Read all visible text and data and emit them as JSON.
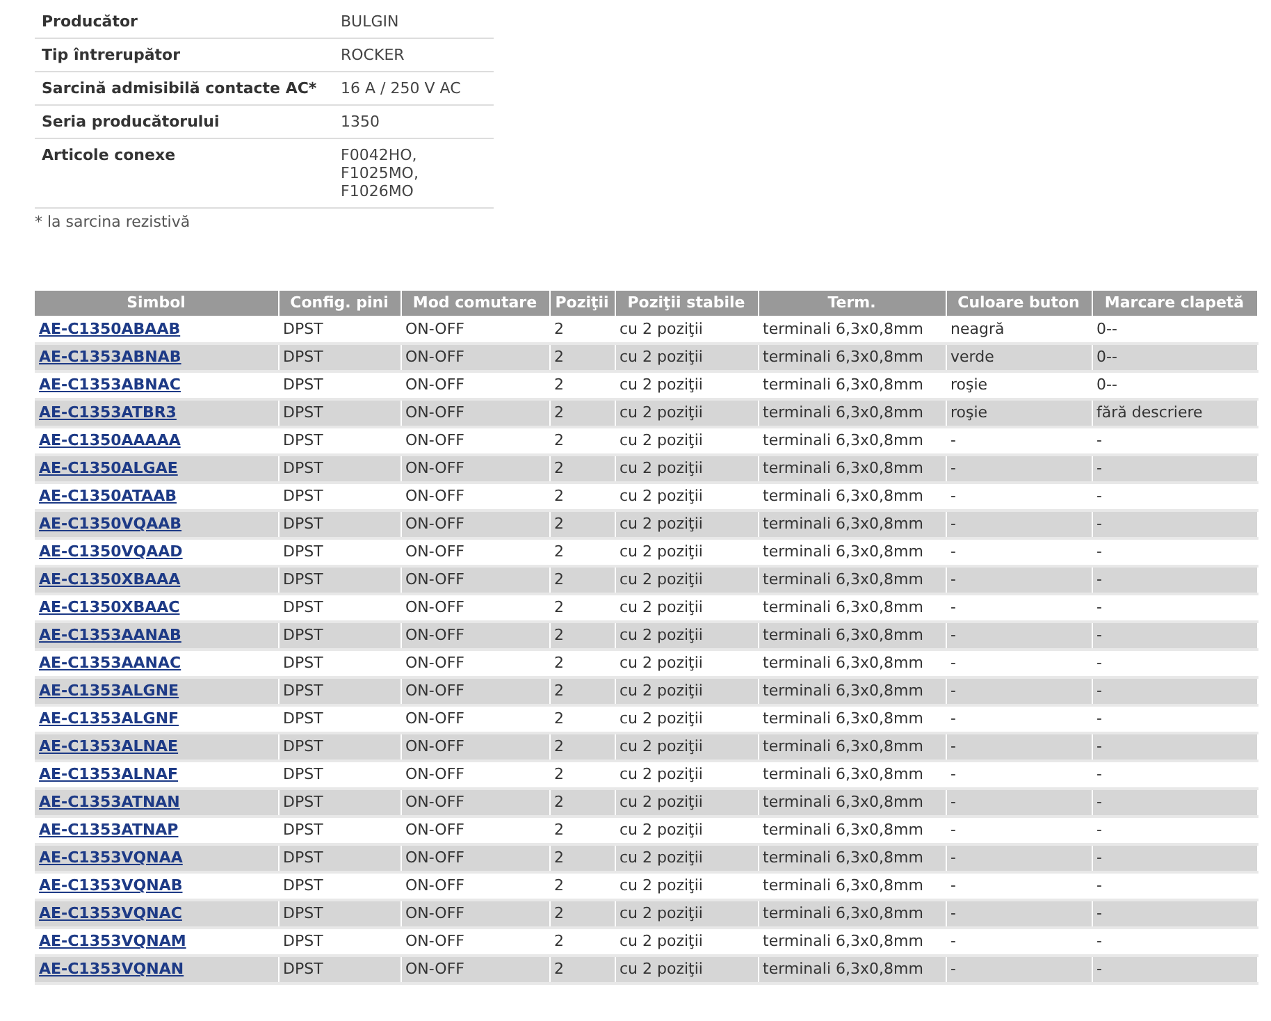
{
  "specs": [
    {
      "label": "Producător",
      "value": "BULGIN"
    },
    {
      "label": "Tip întrerupător",
      "value": "ROCKER"
    },
    {
      "label": "Sarcină admisibilă contacte AC*",
      "value": "16 A / 250 V AC"
    },
    {
      "label": "Seria producătorului",
      "value": "1350"
    },
    {
      "label": "Articole conexe",
      "value": "F0042HO,\nF1025MO,\nF1026MO"
    }
  ],
  "footnote": "* la sarcina rezistivă",
  "table": {
    "columns": [
      "Simbol",
      "Config. pini",
      "Mod comutare",
      "Poziţii",
      "Poziţii stabile",
      "Term.",
      "Culoare buton",
      "Marcare clapetă"
    ],
    "rows": [
      [
        "AE-C1350ABAAB",
        "DPST",
        "ON-OFF",
        "2",
        "cu 2 poziţii",
        "terminali 6,3x0,8mm",
        "neagră",
        "0--"
      ],
      [
        "AE-C1353ABNAB",
        "DPST",
        "ON-OFF",
        "2",
        "cu 2 poziţii",
        "terminali 6,3x0,8mm",
        "verde",
        "0--"
      ],
      [
        "AE-C1353ABNAC",
        "DPST",
        "ON-OFF",
        "2",
        "cu 2 poziţii",
        "terminali 6,3x0,8mm",
        "roşie",
        "0--"
      ],
      [
        "AE-C1353ATBR3",
        "DPST",
        "ON-OFF",
        "2",
        "cu 2 poziţii",
        "terminali 6,3x0,8mm",
        "roşie",
        "fără descriere"
      ],
      [
        "AE-C1350AAAAA",
        "DPST",
        "ON-OFF",
        "2",
        "cu 2 poziţii",
        "terminali 6,3x0,8mm",
        "-",
        "-"
      ],
      [
        "AE-C1350ALGAE",
        "DPST",
        "ON-OFF",
        "2",
        "cu 2 poziţii",
        "terminali 6,3x0,8mm",
        "-",
        "-"
      ],
      [
        "AE-C1350ATAAB",
        "DPST",
        "ON-OFF",
        "2",
        "cu 2 poziţii",
        "terminali 6,3x0,8mm",
        "-",
        "-"
      ],
      [
        "AE-C1350VQAAB",
        "DPST",
        "ON-OFF",
        "2",
        "cu 2 poziţii",
        "terminali 6,3x0,8mm",
        "-",
        "-"
      ],
      [
        "AE-C1350VQAAD",
        "DPST",
        "ON-OFF",
        "2",
        "cu 2 poziţii",
        "terminali 6,3x0,8mm",
        "-",
        "-"
      ],
      [
        "AE-C1350XBAAA",
        "DPST",
        "ON-OFF",
        "2",
        "cu 2 poziţii",
        "terminali 6,3x0,8mm",
        "-",
        "-"
      ],
      [
        "AE-C1350XBAAC",
        "DPST",
        "ON-OFF",
        "2",
        "cu 2 poziţii",
        "terminali 6,3x0,8mm",
        "-",
        "-"
      ],
      [
        "AE-C1353AANAB",
        "DPST",
        "ON-OFF",
        "2",
        "cu 2 poziţii",
        "terminali 6,3x0,8mm",
        "-",
        "-"
      ],
      [
        "AE-C1353AANAC",
        "DPST",
        "ON-OFF",
        "2",
        "cu 2 poziţii",
        "terminali 6,3x0,8mm",
        "-",
        "-"
      ],
      [
        "AE-C1353ALGNE",
        "DPST",
        "ON-OFF",
        "2",
        "cu 2 poziţii",
        "terminali 6,3x0,8mm",
        "-",
        "-"
      ],
      [
        "AE-C1353ALGNF",
        "DPST",
        "ON-OFF",
        "2",
        "cu 2 poziţii",
        "terminali 6,3x0,8mm",
        "-",
        "-"
      ],
      [
        "AE-C1353ALNAE",
        "DPST",
        "ON-OFF",
        "2",
        "cu 2 poziţii",
        "terminali 6,3x0,8mm",
        "-",
        "-"
      ],
      [
        "AE-C1353ALNAF",
        "DPST",
        "ON-OFF",
        "2",
        "cu 2 poziţii",
        "terminali 6,3x0,8mm",
        "-",
        "-"
      ],
      [
        "AE-C1353ATNAN",
        "DPST",
        "ON-OFF",
        "2",
        "cu 2 poziţii",
        "terminali 6,3x0,8mm",
        "-",
        "-"
      ],
      [
        "AE-C1353ATNAP",
        "DPST",
        "ON-OFF",
        "2",
        "cu 2 poziţii",
        "terminali 6,3x0,8mm",
        "-",
        "-"
      ],
      [
        "AE-C1353VQNAA",
        "DPST",
        "ON-OFF",
        "2",
        "cu 2 poziţii",
        "terminali 6,3x0,8mm",
        "-",
        "-"
      ],
      [
        "AE-C1353VQNAB",
        "DPST",
        "ON-OFF",
        "2",
        "cu 2 poziţii",
        "terminali 6,3x0,8mm",
        "-",
        "-"
      ],
      [
        "AE-C1353VQNAC",
        "DPST",
        "ON-OFF",
        "2",
        "cu 2 poziţii",
        "terminali 6,3x0,8mm",
        "-",
        "-"
      ],
      [
        "AE-C1353VQNAM",
        "DPST",
        "ON-OFF",
        "2",
        "cu 2 poziţii",
        "terminali 6,3x0,8mm",
        "-",
        "-"
      ],
      [
        "AE-C1353VQNAN",
        "DPST",
        "ON-OFF",
        "2",
        "cu 2 poziţii",
        "terminali 6,3x0,8mm",
        "-",
        "-"
      ]
    ]
  }
}
